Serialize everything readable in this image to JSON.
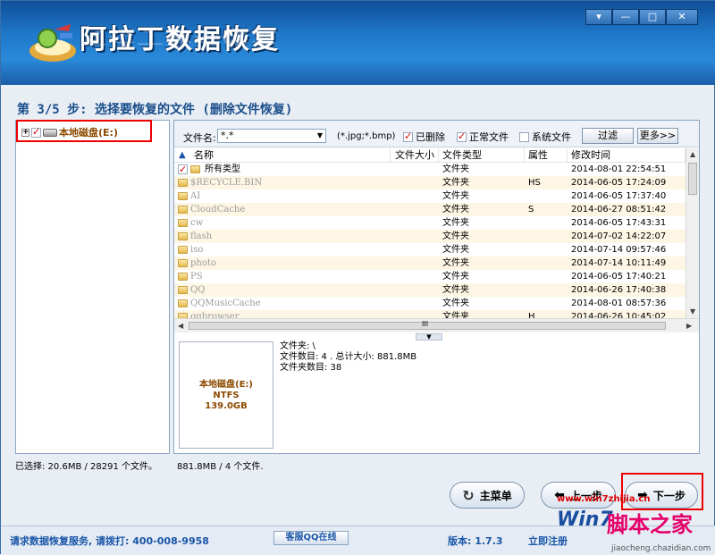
{
  "app": {
    "title": "阿拉丁数据恢复",
    "window_controls": [
      "▾",
      "—",
      "□",
      "✕"
    ]
  },
  "step_title": "第 3/5 步: 选择要恢复的文件 (删除文件恢复)",
  "tree": {
    "drive_label": "本地磁盘(E:)",
    "expander": "+"
  },
  "filter": {
    "label": "文件名:",
    "value": "*.*",
    "hint": "(*.jpg;*.bmp)",
    "deleted_label": "已删除",
    "normal_label": "正常文件",
    "system_label": "系统文件",
    "filter_button": "过滤",
    "more_button": "更多>>"
  },
  "grid": {
    "columns": [
      "名称",
      "文件大小",
      "文件类型",
      "属性",
      "修改时间"
    ],
    "rows": [
      {
        "name": "所有类型",
        "size": "",
        "type": "文件夹",
        "attr": "",
        "date": "2014-08-01 22:54:51"
      },
      {
        "name": "$RECYCLE.BIN",
        "size": "",
        "type": "文件夹",
        "attr": "HS",
        "date": "2014-06-05 17:24:09"
      },
      {
        "name": "AI",
        "size": "",
        "type": "文件夹",
        "attr": "",
        "date": "2014-06-05 17:37:40"
      },
      {
        "name": "CloudCache",
        "size": "",
        "type": "文件夹",
        "attr": "S",
        "date": "2014-06-27 08:51:42"
      },
      {
        "name": "cw",
        "size": "",
        "type": "文件夹",
        "attr": "",
        "date": "2014-06-05 17:43:31"
      },
      {
        "name": "flash",
        "size": "",
        "type": "文件夹",
        "attr": "",
        "date": "2014-07-02 14:22:07"
      },
      {
        "name": "iso",
        "size": "",
        "type": "文件夹",
        "attr": "",
        "date": "2014-07-14 09:57:46"
      },
      {
        "name": "photo",
        "size": "",
        "type": "文件夹",
        "attr": "",
        "date": "2014-07-14 10:11:49"
      },
      {
        "name": "PS",
        "size": "",
        "type": "文件夹",
        "attr": "",
        "date": "2014-06-05 17:40:21"
      },
      {
        "name": "QQ",
        "size": "",
        "type": "文件夹",
        "attr": "",
        "date": "2014-06-26 17:40:38"
      },
      {
        "name": "QQMusicCache",
        "size": "",
        "type": "文件夹",
        "attr": "",
        "date": "2014-08-01 08:57:36"
      },
      {
        "name": "qqbrowser",
        "size": "",
        "type": "文件夹",
        "attr": "H",
        "date": "2014-06-26 10:45:02"
      }
    ],
    "hscroll_grip": "III"
  },
  "drive_card": {
    "name": "本地磁盘(E:)",
    "fs": "NTFS",
    "size": "139.0GB"
  },
  "info": {
    "folder_line": "文件夹: \\",
    "count_line": "文件数目: 4 . 总计大小: 881.8MB",
    "folders_line": "文件夹数目: 38"
  },
  "status": {
    "selected": "已选择: 20.6MB / 28291 个文件。",
    "current": "881.8MB / 4 个文件."
  },
  "buttons": {
    "main_menu": "主菜单",
    "prev": "上一步",
    "next": "下一步"
  },
  "footer": {
    "hotline": "请求数据恢复服务, 请拨打: 400-008-9958",
    "qq": "客服QQ在线",
    "version": "版本: 1.7.3",
    "register": "立即注册"
  },
  "watermark": {
    "url": "www.win7zhijia.cn",
    "text": "脚本之家",
    "win7": "Win7",
    "small": "jiaocheng.chazidian.com"
  },
  "colors": {
    "header": "#1f78c9",
    "highlight_box": "#e00000",
    "link_blue": "#1a56a8"
  }
}
